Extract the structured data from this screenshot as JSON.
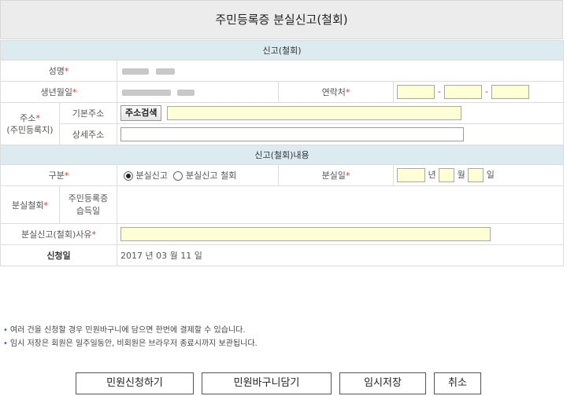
{
  "page_title": "주민등록증 분실신고(철회)",
  "section1_title": "신고(철회)",
  "name": {
    "label": "성명",
    "required_mark": "*"
  },
  "birthdate": {
    "label": "생년월일",
    "required_mark": "*"
  },
  "contact": {
    "label": "연락처",
    "required_mark": "*",
    "separator": "-"
  },
  "address": {
    "label": "주소",
    "required_mark": "*",
    "sublabel": "(주민등록지)",
    "base_label": "기본주소",
    "search_button": "주소검색",
    "detail_label": "상세주소"
  },
  "section2_title": "신고(철회)내용",
  "type": {
    "label": "구분",
    "required_mark": "*",
    "option1": "분실신고",
    "option2": "분실신고 철회",
    "selected": "분실신고"
  },
  "lost_date": {
    "label": "분실일",
    "required_mark": "*",
    "year_unit": "년",
    "month_unit": "월",
    "day_unit": "일"
  },
  "withdrawal": {
    "label": "분실철회",
    "required_mark": "*",
    "sub_line1": "주민등록증",
    "sub_line2": "습득일"
  },
  "reason": {
    "label": "분실신고(철회)사유",
    "required_mark": "*"
  },
  "apply_date": {
    "label": "신청일",
    "value": "2017 년 03 월 11 일"
  },
  "notes": [
    "여러 건을 신청할 경우 민원바구니에 담으면 한번에 결제할 수 있습니다.",
    "임시 저장은 회원은 일주일동안, 비회원은 브라우저 종료시까지 보관됩니다."
  ],
  "actions": {
    "apply": "민원신청하기",
    "basket": "민원바구니담기",
    "temp_save": "임시저장",
    "cancel": "취소"
  },
  "colors": {
    "section_bg": "#dcebf0",
    "required": "#e0362a",
    "input_yellow": "#ffffd6"
  }
}
